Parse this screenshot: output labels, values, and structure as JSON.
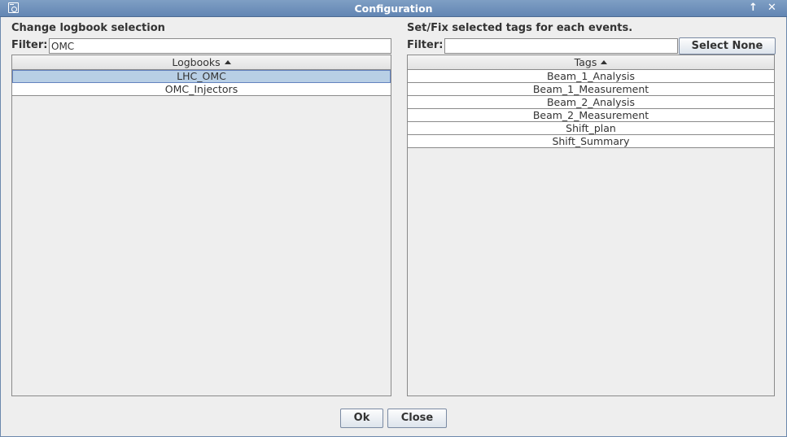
{
  "window": {
    "title": "Configuration"
  },
  "left": {
    "section_title": "Change logbook selection",
    "filter_label": "Filter:",
    "filter_value": "OMC",
    "column_header": "Logbooks",
    "rows": [
      "LHC_OMC",
      "OMC_Injectors"
    ],
    "selected_index": 0
  },
  "right": {
    "section_title": "Set/Fix selected tags for each events.",
    "filter_label": "Filter:",
    "filter_value": "",
    "select_none_label": "Select None",
    "column_header": "Tags",
    "rows": [
      "Beam_1_Analysis",
      "Beam_1_Measurement",
      "Beam_2_Analysis",
      "Beam_2_Measurement",
      "Shift_plan",
      "Shift_Summary"
    ]
  },
  "footer": {
    "ok_label": "Ok",
    "close_label": "Close"
  },
  "icons": {
    "window": "window-icon",
    "maximize": "maximize-icon",
    "close": "close-icon",
    "sort": "sort-ascending-icon"
  },
  "colors": {
    "titlebar": "#6285b3",
    "selection": "#b8cfe5"
  }
}
